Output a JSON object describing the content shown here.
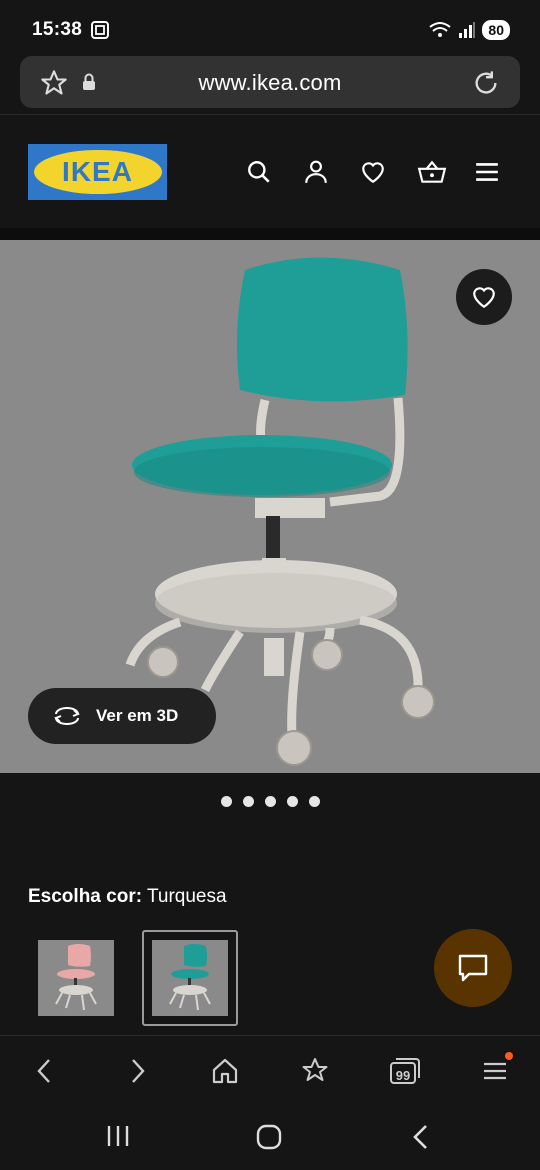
{
  "status": {
    "time": "15:38",
    "battery": "80"
  },
  "browser": {
    "url": "www.ikea.com"
  },
  "header": {
    "logo_text": "IKEA"
  },
  "product": {
    "view3d_label": "Ver em 3D",
    "image_count": 5,
    "color_label": "Escolha cor:",
    "color_value": "Turquesa",
    "colors": {
      "turquoise": "#1f9e98",
      "pink": "#e8a8a8",
      "frame": "#d9d6d0"
    }
  },
  "nav": {
    "badge": "99"
  }
}
